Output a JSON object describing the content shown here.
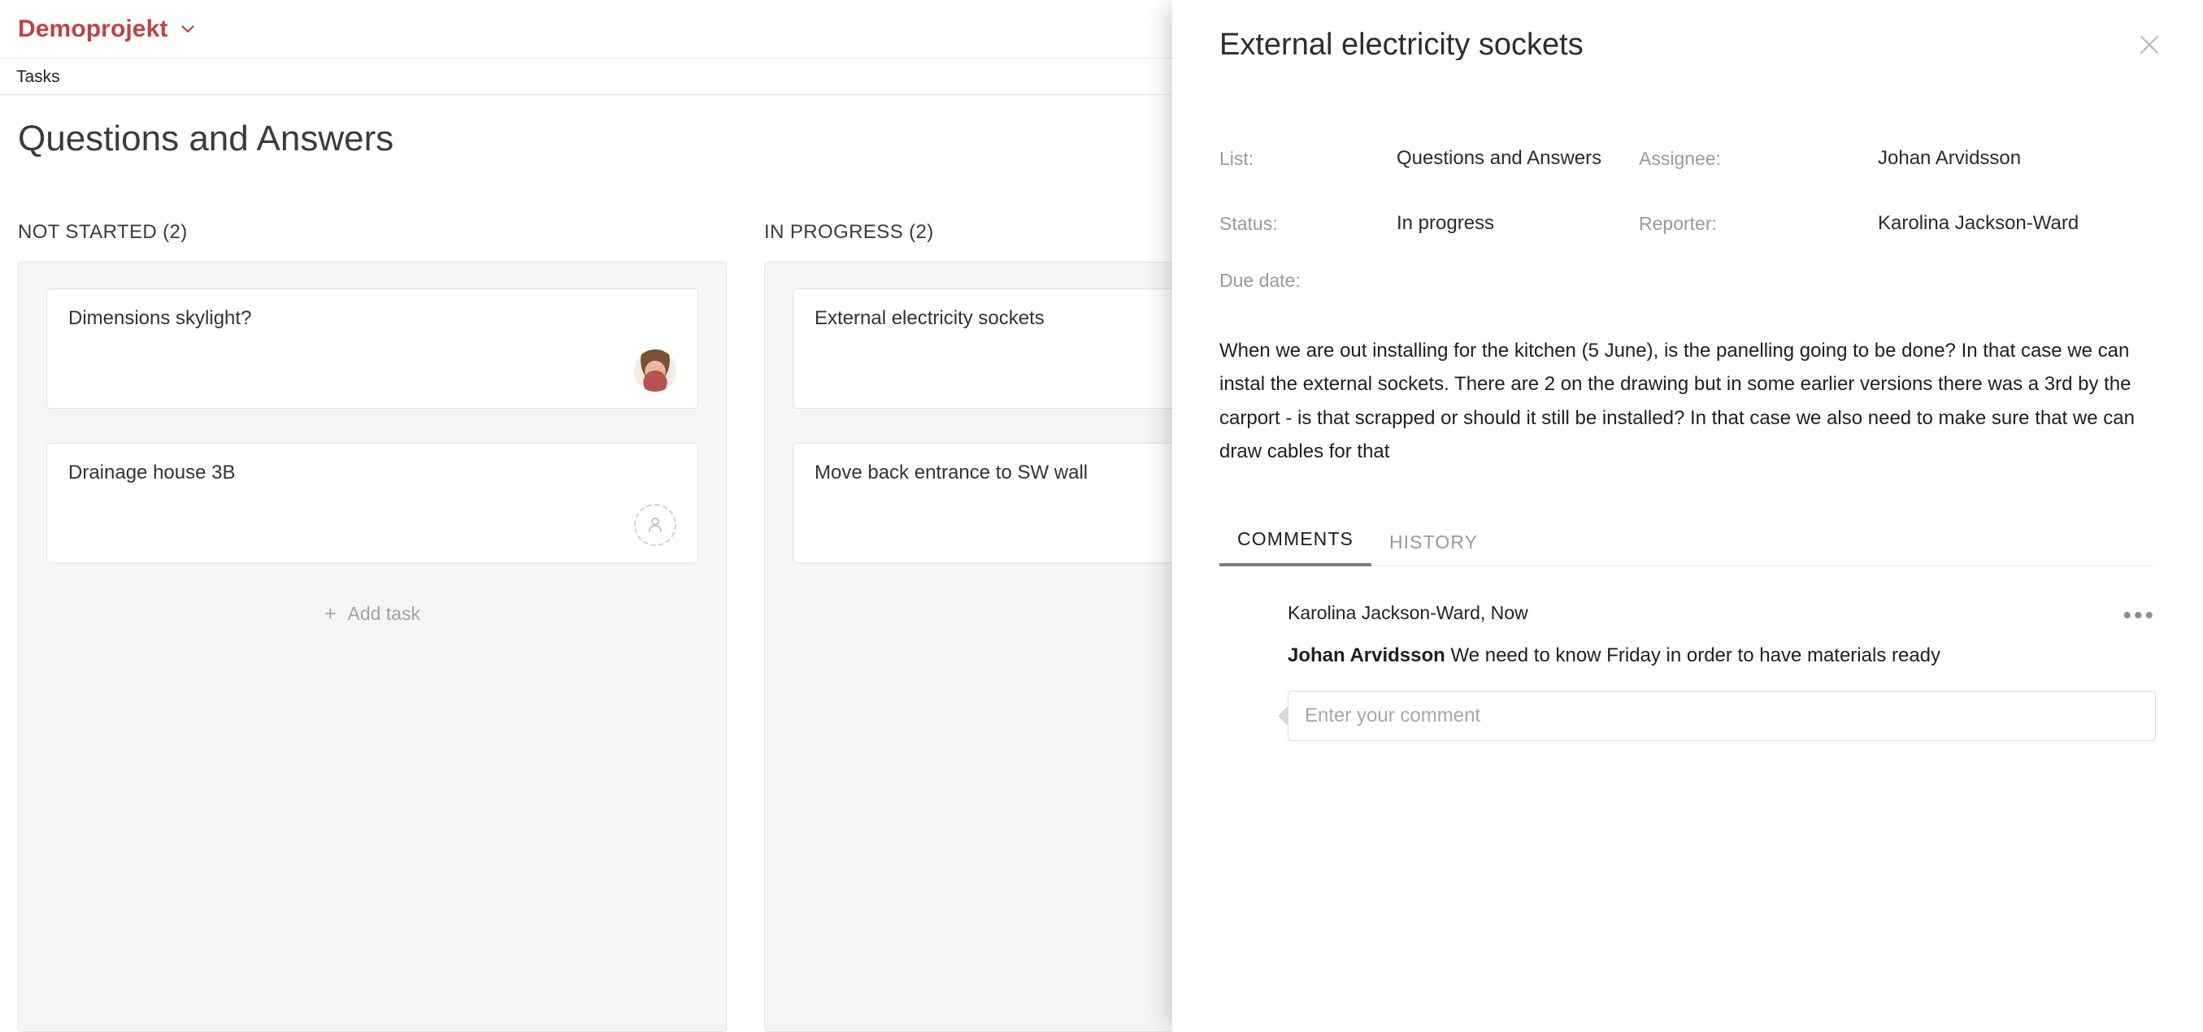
{
  "topbar": {
    "project_name": "Demoprojekt",
    "chevron_icon": "chevron-down-icon",
    "accent_color": "#be4343"
  },
  "nav_tabs": [
    {
      "label": "Tasks",
      "active": true
    }
  ],
  "board": {
    "title": "Questions and Answers",
    "add_task_label": "Add task",
    "add_task_plus": "+",
    "columns": [
      {
        "header": "NOT STARTED (2)",
        "status": "not-started",
        "count": 2,
        "tasks": [
          {
            "title": "Dimensions skylight?",
            "avatar": "photo-woman",
            "has_assignee": true
          },
          {
            "title": "Drainage house 3B",
            "avatar": "empty-user-icon",
            "has_assignee": false
          }
        ],
        "show_add_task": true
      },
      {
        "header": "IN PROGRESS (2)",
        "status": "in-progress",
        "count": 2,
        "tasks": [
          {
            "title": "External electricity sockets",
            "avatar": "photo-man",
            "has_assignee": false
          },
          {
            "title": "Move back entrance to SW wall",
            "avatar": "photo-man",
            "has_assignee": false
          }
        ],
        "show_add_task": false
      }
    ]
  },
  "panel": {
    "title": "External electricity sockets",
    "close_icon": "close-icon",
    "meta": {
      "list_label": "List:",
      "list_value": "Questions and Answers",
      "status_label": "Status:",
      "status_value": "In progress",
      "due_date_label": "Due date:",
      "due_date_value": "",
      "assignee_label": "Assignee:",
      "assignee_name": "Johan Arvidsson",
      "assignee_avatar": "photo-man",
      "reporter_label": "Reporter:",
      "reporter_name": "Karolina Jackson-Ward",
      "reporter_avatar": "photo-doc"
    },
    "description": "When we are out installing for the kitchen (5 June), is the panelling going to be done? In that case we can instal the external sockets. There are 2 on the drawing but in some earlier versions there was a 3rd by the carport - is that scrapped or should it still be installed? In that case we also need to make sure that we can draw cables for that",
    "tabs": [
      {
        "label": "COMMENTS",
        "active": true
      },
      {
        "label": "HISTORY",
        "active": false
      }
    ],
    "comments": [
      {
        "author": "Karolina Jackson-Ward",
        "timestamp": "Now",
        "meta_line": "Karolina Jackson-Ward, Now",
        "mention": "Johan Arvidsson",
        "body": " We need to know Friday in order to have materials ready",
        "avatar": "photo-doc",
        "menu_icon": "kebab-menu-icon",
        "menu_glyph": "•••"
      }
    ],
    "composer": {
      "avatar": "photo-doc",
      "placeholder": "Enter your comment",
      "value": ""
    }
  }
}
